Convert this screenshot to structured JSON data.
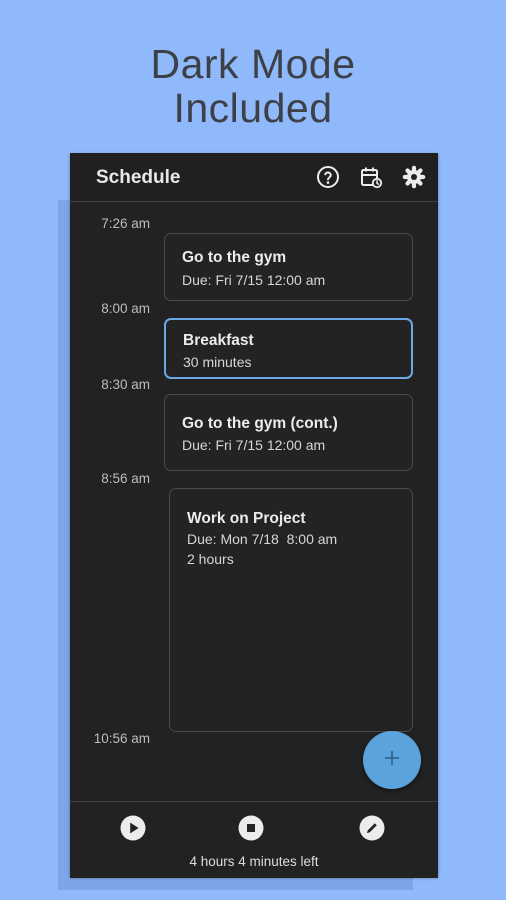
{
  "headline": {
    "line1": "Dark Mode",
    "line2": "Included"
  },
  "appbar": {
    "title": "Schedule",
    "icons": [
      "help-icon",
      "calendar-icon",
      "settings-icon"
    ]
  },
  "timeline": {
    "times": [
      "7:26 am",
      "8:00 am",
      "8:30 am",
      "8:56 am",
      "10:56 am"
    ]
  },
  "tasks": [
    {
      "title": "Go to the gym",
      "lines": [
        "Due: Fri 7/15 12:00 am"
      ],
      "selected": false
    },
    {
      "title": "Breakfast",
      "lines": [
        "30 minutes"
      ],
      "selected": true
    },
    {
      "title": "Go to the gym (cont.)",
      "lines": [
        "Due: Fri 7/15 12:00 am"
      ],
      "selected": false
    },
    {
      "title": "Work on Project",
      "lines": [
        "Due: Mon 7/18  8:00 am",
        "2 hours"
      ],
      "selected": false
    }
  ],
  "fab": {
    "icon": "plus-icon",
    "label": "+"
  },
  "bottom_bar": {
    "icons": [
      "play-icon",
      "stop-icon",
      "edit-icon"
    ],
    "remaining": "4 hours 4 minutes left"
  },
  "colors": {
    "background": "#8fb9fb",
    "surface": "#222222",
    "accent": "#5aa3dd",
    "selected_border": "#6aa8e8"
  }
}
